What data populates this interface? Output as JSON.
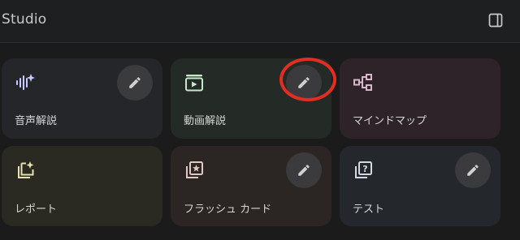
{
  "header": {
    "title": "Studio",
    "panel_toggle_icon": "side-panel-icon"
  },
  "cards": [
    {
      "label": "音声解説",
      "icon": "audio-wave-sparkle-icon",
      "has_edit": true,
      "accent": "#c9c9ff"
    },
    {
      "label": "動画解説",
      "icon": "video-play-icon",
      "has_edit": true,
      "accent": "#c8e6c9"
    },
    {
      "label": "マインドマップ",
      "icon": "mind-map-icon",
      "has_edit": false,
      "accent": "#d7b6cc"
    },
    {
      "label": "レポート",
      "icon": "report-sparkle-icon",
      "has_edit": false,
      "accent": "#e7e3b3"
    },
    {
      "label": "フラッシュ カード",
      "icon": "flashcards-star-icon",
      "has_edit": true,
      "accent": "#e1c7c0"
    },
    {
      "label": "テスト",
      "icon": "quiz-question-icon",
      "has_edit": true,
      "accent": "#d3d9e0"
    }
  ],
  "colors": {
    "background": "#1b1b1c",
    "header": "#1e1f20",
    "annotation": "#e12e23"
  },
  "annotation": {
    "type": "highlight-circle",
    "target": "video-explanation-edit-button"
  }
}
